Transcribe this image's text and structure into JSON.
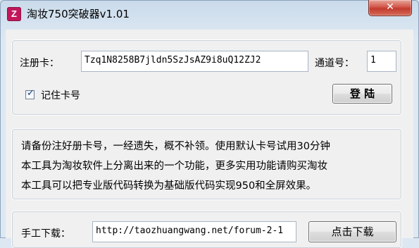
{
  "window": {
    "app_icon_glyph": "Z",
    "title": "淘妆750突破器v1.01",
    "close_glyph": "✕"
  },
  "login": {
    "reg_card_label": "注册卡：",
    "reg_card_value": "Tzq1N8258B7jldn5SzJsAZ9i8uQ12ZJ2",
    "channel_label": "通道号：",
    "channel_value": "1",
    "remember_label": "记住卡号",
    "remember_checked": true,
    "login_button": "登 陆"
  },
  "notice": {
    "lines": [
      "请备份注好册卡号，一经遗失，概不补领。使用默认卡号试用30分钟",
      "本工具为淘妆软件上分离出来的一个功能，更多实用功能请购买淘妆",
      "本工具可以把专业版代码转换为基础版代码实现950和全屏效果。"
    ]
  },
  "download": {
    "label": "手工下载：",
    "url": "http://taozhuangwang.net/forum-2-1",
    "button": "点击下载"
  }
}
